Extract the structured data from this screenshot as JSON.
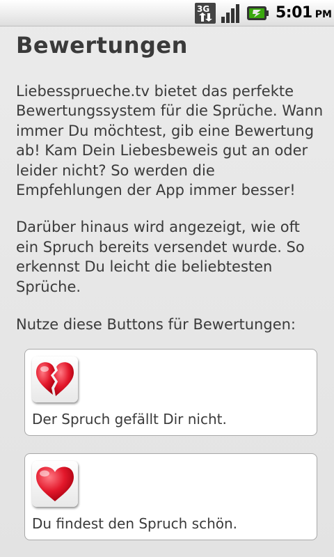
{
  "status_bar": {
    "network_label": "3G",
    "time": "5:01",
    "ampm": "PM",
    "icons": [
      "3g-data-icon",
      "signal-strength-icon",
      "battery-charging-icon"
    ]
  },
  "page": {
    "title": "Bewertungen",
    "paragraphs": [
      "Liebessprueche.tv bietet das perfekte Bewertungssystem für die Sprüche. Wann immer Du möchtest, gib eine Bewertung ab! Kam Dein Liebesbeweis gut an oder leider nicht? So werden die Empfehlungen der App immer besser!",
      "Darüber hinaus wird angezeigt, wie oft ein Spruch bereits versendet wurde. So erkennst Du leicht die beliebtesten Sprüche.",
      "Nutze diese Buttons für Bewertungen:"
    ]
  },
  "ratings": [
    {
      "icon": "broken-heart-icon",
      "label": "Der Spruch gefällt Dir nicht."
    },
    {
      "icon": "heart-icon",
      "label": "Du findest den Spruch schön."
    }
  ],
  "colors": {
    "background": "#e8e8e8",
    "text": "#3a3a3a",
    "heart_red": "#e01a2a",
    "battery_green": "#3aa80e"
  }
}
